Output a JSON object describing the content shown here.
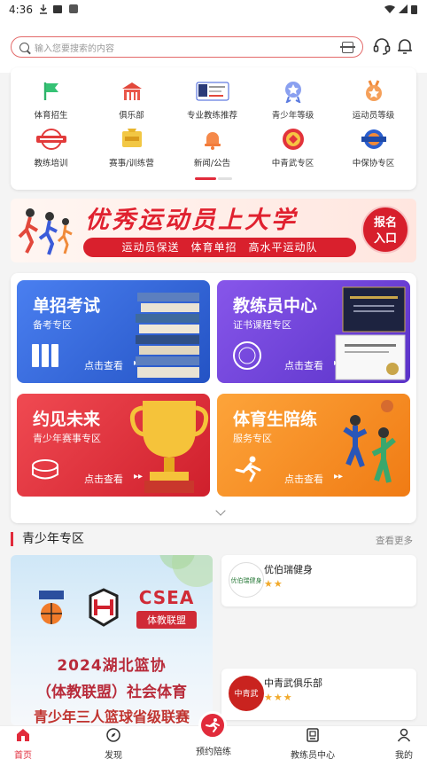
{
  "status_bar": {
    "time": "4:36"
  },
  "search": {
    "placeholder": "输入您要搜索的内容"
  },
  "menu": {
    "items": [
      {
        "label": "体育招生",
        "color": "#2fb36a"
      },
      {
        "label": "俱乐部",
        "color": "#e2483b"
      },
      {
        "label": "专业教练推荐",
        "color": "#3b5bd9"
      },
      {
        "label": "青少年等级",
        "color": "#5b7be0"
      },
      {
        "label": "运动员等级",
        "color": "#f08a3a"
      },
      {
        "label": "教练培训",
        "color": "#e23b3b"
      },
      {
        "label": "赛事/训练营",
        "color": "#e8b52c"
      },
      {
        "label": "新闻/公告",
        "color": "#f27b3a"
      },
      {
        "label": "中青武专区",
        "color": "#e2333b"
      },
      {
        "label": "中保协专区",
        "color": "#2b5fcf"
      }
    ]
  },
  "banner": {
    "title": "优秀运动员上大学",
    "subtitle": "运动员保送　体育单招　高水平运动队",
    "button": [
      "报名",
      "入口"
    ]
  },
  "tiles": [
    {
      "title": "单招考试",
      "subtitle": "备考专区",
      "cta": "点击查看",
      "color": "#2f63d6"
    },
    {
      "title": "教练员中心",
      "subtitle": "证书课程专区",
      "cta": "点击查看",
      "color": "#6a3fd8"
    },
    {
      "title": "约见未来",
      "subtitle": "青少年赛事专区",
      "cta": "点击查看",
      "color": "#e0303c"
    },
    {
      "title": "体育生陪练",
      "subtitle": "服务专区",
      "cta": "点击查看",
      "color": "#f58a1f"
    }
  ],
  "youth": {
    "title": "青少年专区",
    "more": "查看更多",
    "poster": {
      "brand_main": "CSEA",
      "brand_sub": "体教联盟",
      "line1": "2024湖北篮协",
      "line2": "（体教联盟）社会体育",
      "line3": "青少年三人篮球省级联赛"
    },
    "clubs": [
      {
        "name": "优伯瑞健身",
        "stars": "★★",
        "logo_text": "优伯瑞健身"
      },
      {
        "name": "中青武俱乐部",
        "stars": "★★★",
        "logo_text": "中青武"
      }
    ]
  },
  "tabbar": {
    "items": [
      {
        "label": "首页"
      },
      {
        "label": "发现"
      },
      {
        "label": "预约陪练"
      },
      {
        "label": "教练员中心"
      },
      {
        "label": "我的"
      }
    ]
  },
  "colors": {
    "accent": "#e12b3b"
  }
}
